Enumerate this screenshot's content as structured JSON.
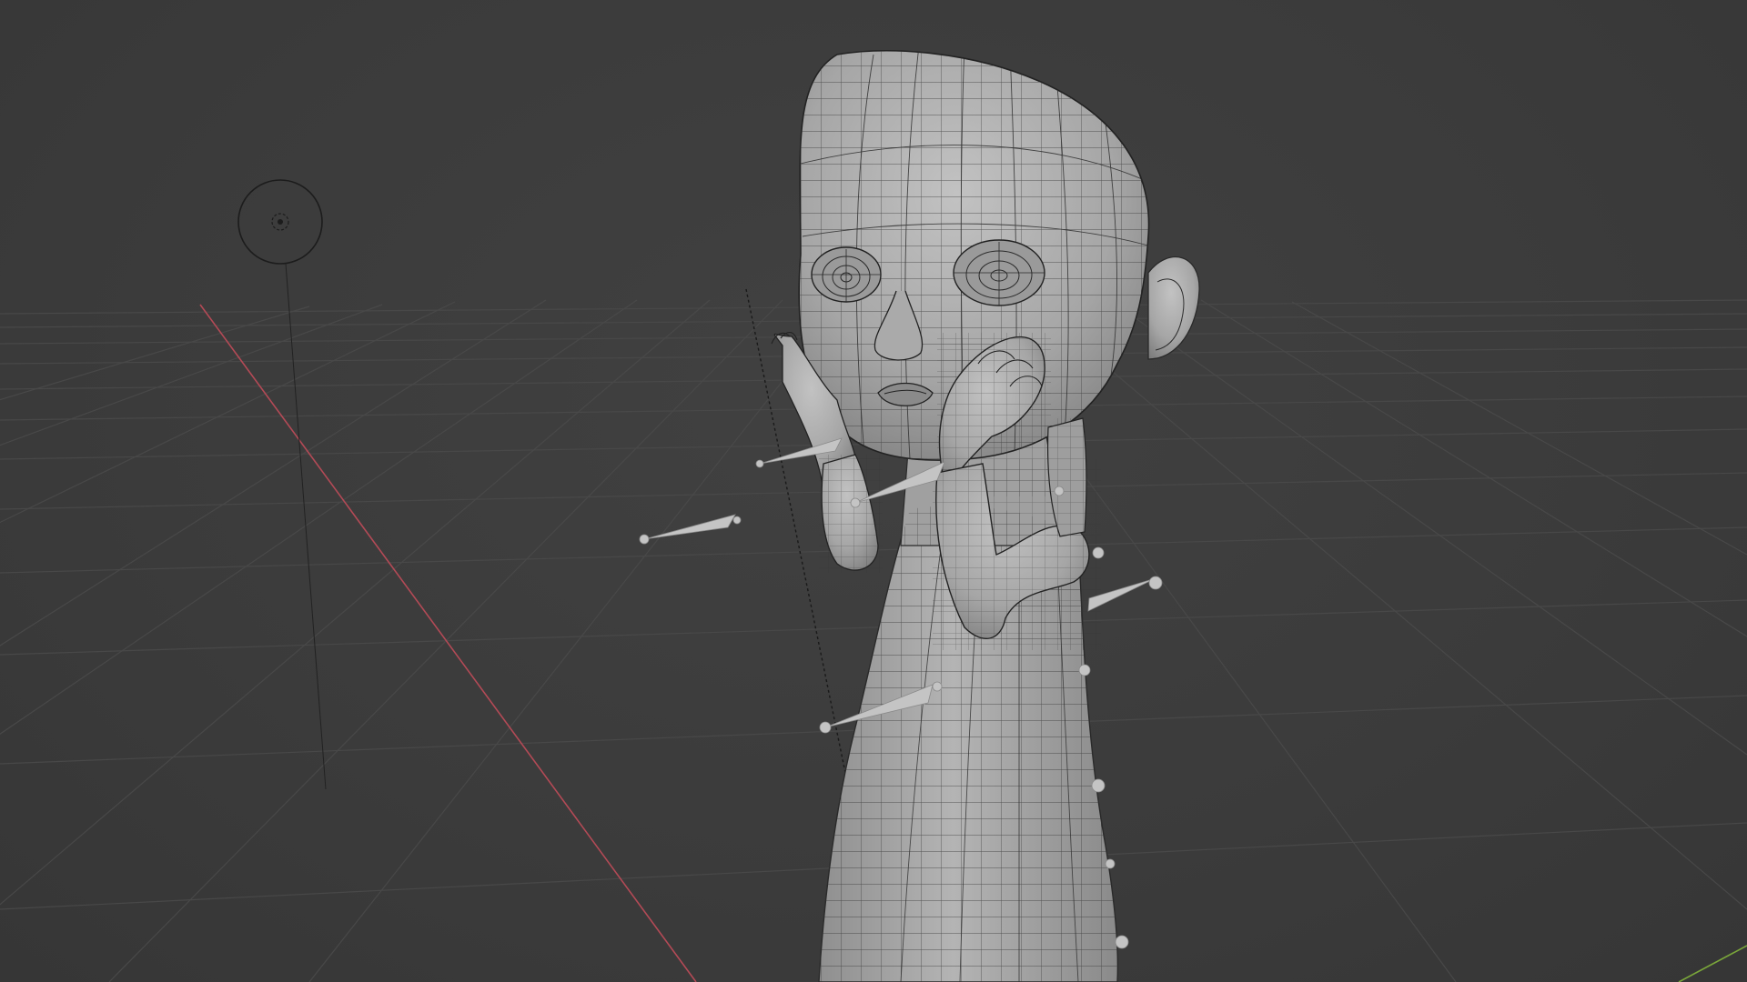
{
  "viewport": {
    "mode": "3D Viewport",
    "shading": "solid-wireframe-overlay",
    "background_color": "#3d3d3d",
    "grid_color": "#4e4e4e",
    "x_axis_color": "#b34a56",
    "y_axis_color": "#7aa63a",
    "mesh_color": "#a8a8a8",
    "wire_color": "#2a2a2a",
    "bone_color": "#bdbdbd"
  },
  "scene_objects": [
    {
      "name": "light",
      "icon": "light-icon"
    },
    {
      "name": "character-mesh",
      "icon": "mesh-icon"
    },
    {
      "name": "armature",
      "icon": "armature-icon"
    }
  ]
}
